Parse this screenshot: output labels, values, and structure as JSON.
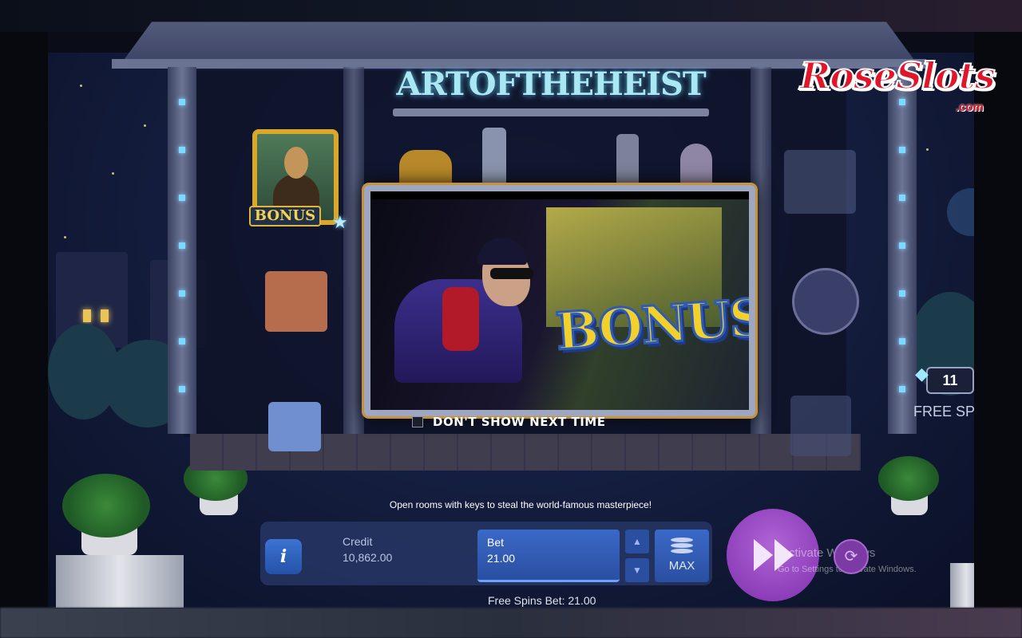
{
  "game": {
    "title": "Art of the Heist",
    "title_display": "ARTOFTHEHEIST"
  },
  "brand": {
    "logo_text": "RoseSlots",
    "logo_sub": ".com"
  },
  "reels": {
    "bonus_symbol_label": "BONUS"
  },
  "popup": {
    "banner_text": "BONUS",
    "dont_show_label": "DON'T SHOW NEXT TIME"
  },
  "free_spins": {
    "remaining": "11",
    "label": "FREE SP"
  },
  "hint_text": "Open rooms with keys to steal the world-famous masterpiece!",
  "controls": {
    "info_label": "i",
    "credit_label": "Credit",
    "credit_value": "10,862.00",
    "bet_label": "Bet",
    "bet_value": "21.00",
    "max_label": "MAX",
    "free_spins_bet": "Free Spins Bet: 21.00"
  },
  "os_overlay": {
    "line1": "ctivate Windows",
    "line2": "Go to Settings to activate Windows."
  },
  "colors": {
    "spin_button": "#8e3fba",
    "bet_panel": "#2a4fa1",
    "logo_red": "#e0162b",
    "bonus_gold": "#f2d12c"
  }
}
